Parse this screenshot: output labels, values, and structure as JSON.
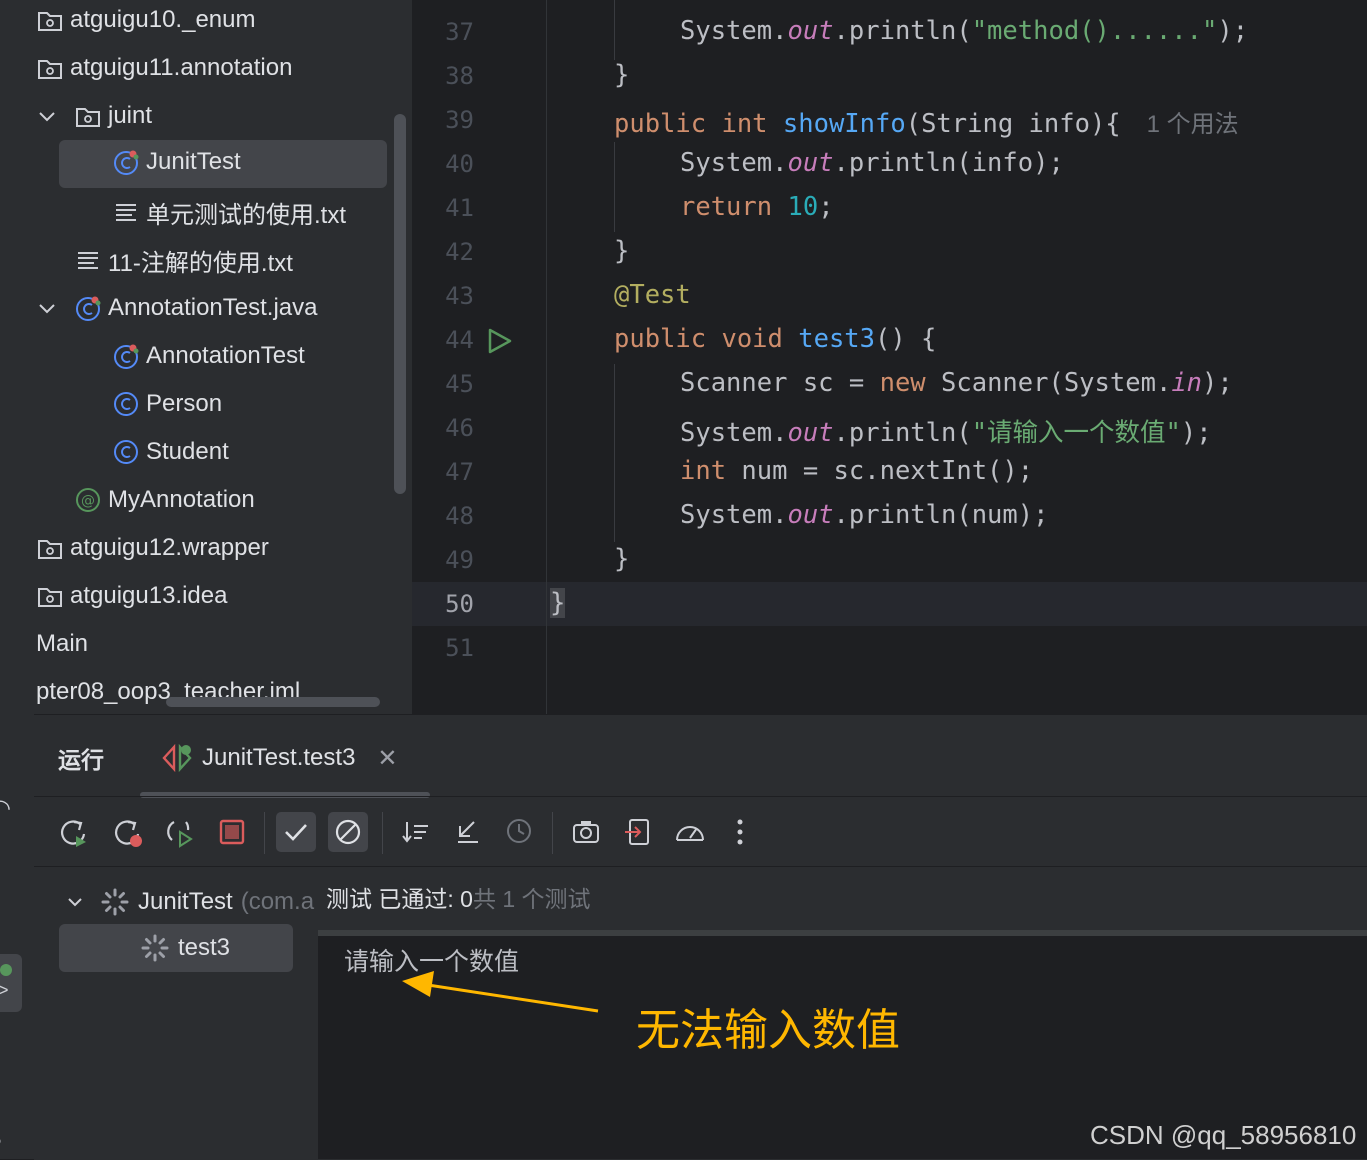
{
  "project_tree": {
    "items": [
      {
        "label": "atguigu10._enum",
        "icon": "package-folder-icon"
      },
      {
        "label": "atguigu11.annotation",
        "icon": "package-folder-icon"
      },
      {
        "label": "juint",
        "icon": "package-folder-icon",
        "expanded": true
      },
      {
        "label": "JunitTest",
        "icon": "test-class-icon",
        "selected": true
      },
      {
        "label": "单元测试的使用.txt",
        "icon": "text-file-icon"
      },
      {
        "label": "11-注解的使用.txt",
        "icon": "text-file-icon"
      },
      {
        "label": "AnnotationTest.java",
        "icon": "test-class-icon",
        "expanded": true
      },
      {
        "label": "AnnotationTest",
        "icon": "test-class-icon"
      },
      {
        "label": "Person",
        "icon": "class-icon"
      },
      {
        "label": "Student",
        "icon": "class-icon"
      },
      {
        "label": "MyAnnotation",
        "icon": "annotation-icon"
      },
      {
        "label": "atguigu12.wrapper",
        "icon": "package-folder-icon"
      },
      {
        "label": "atguigu13.idea",
        "icon": "package-folder-icon"
      },
      {
        "label": "Main",
        "icon": ""
      },
      {
        "label": "pter08_oop3_teacher.iml",
        "icon": ""
      }
    ]
  },
  "editor": {
    "line_numbers": [
      "37",
      "38",
      "39",
      "40",
      "41",
      "42",
      "43",
      "44",
      "45",
      "46",
      "47",
      "48",
      "49",
      "50",
      "51"
    ],
    "current_line": "50",
    "usage_hint": "1 个用法",
    "lines": {
      "l37": [
        "System.",
        "out",
        ".println(",
        "\"method()......\"",
        ");"
      ],
      "l38": [
        "}"
      ],
      "l39": [
        "public int ",
        "showInfo",
        "(String info){"
      ],
      "l40": [
        "System.",
        "out",
        ".println(info);"
      ],
      "l41": [
        "return ",
        "10",
        ";"
      ],
      "l42": [
        "}"
      ],
      "l43": [
        "@Test"
      ],
      "l44": [
        "public void ",
        "test3",
        "() {"
      ],
      "l45": [
        "Scanner sc = ",
        "new ",
        "Scanner(System.",
        "in",
        ");"
      ],
      "l46": [
        "System.",
        "out",
        ".println(",
        "\"请输入一个数值\"",
        ");"
      ],
      "l47": [
        "int ",
        "num = sc.nextInt();"
      ],
      "l48": [
        "System.",
        "out",
        ".println(num);"
      ],
      "l49": [
        "}"
      ],
      "l50": [
        "}"
      ]
    }
  },
  "run_panel": {
    "title": "运行",
    "tab_label": "JunitTest.test3",
    "tree_root_label": "JunitTest",
    "tree_root_suffix": "(com.a",
    "tree_child_label": "test3",
    "status_prefix": "测试 已通过: 0",
    "status_suffix": "共 1 个测试",
    "console_output": "请输入一个数值"
  },
  "annotation": {
    "text": "无法输入数值",
    "color": "#ffb700"
  },
  "watermark": "CSDN @qq_58956810"
}
